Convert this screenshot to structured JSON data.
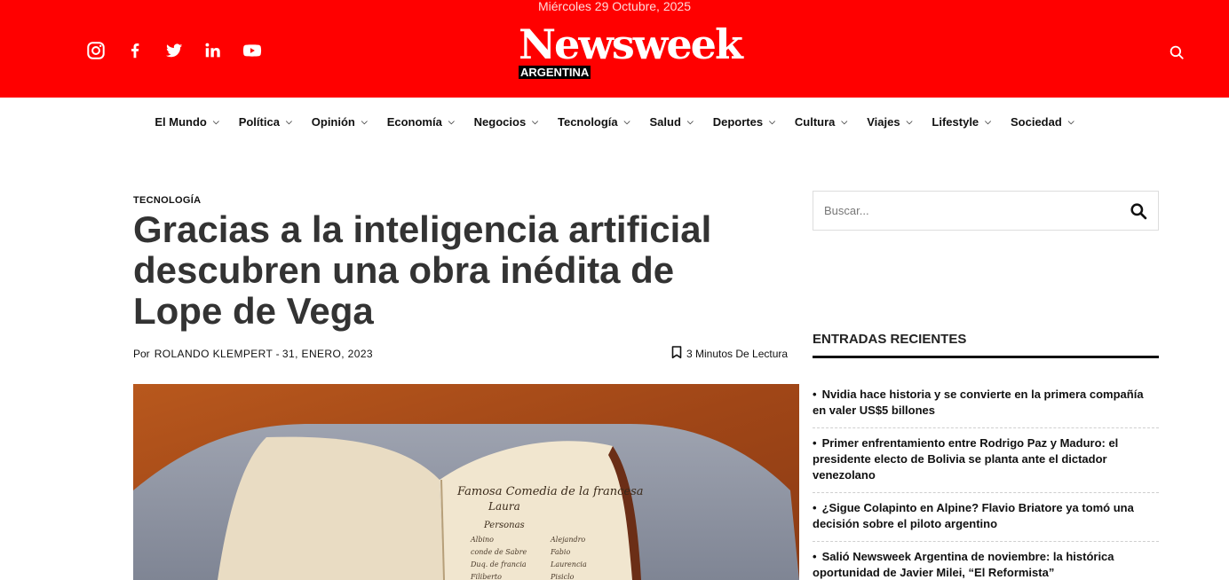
{
  "header": {
    "date": "Miércoles 29 Octubre, 2025",
    "brand": "Newsweek",
    "brand_sub": "ARGENTINA",
    "social_icons": [
      "instagram-icon",
      "facebook-icon",
      "twitter-icon",
      "linkedin-icon",
      "youtube-icon"
    ],
    "bg_color": "#ff0000"
  },
  "nav": {
    "items": [
      {
        "label": "El Mundo"
      },
      {
        "label": "Política"
      },
      {
        "label": "Opinión"
      },
      {
        "label": "Economía"
      },
      {
        "label": "Negocios"
      },
      {
        "label": "Tecnología"
      },
      {
        "label": "Salud"
      },
      {
        "label": "Deportes"
      },
      {
        "label": "Cultura"
      },
      {
        "label": "Viajes"
      },
      {
        "label": "Lifestyle"
      },
      {
        "label": "Sociedad"
      }
    ]
  },
  "article": {
    "category": "TECNOLOGÍA",
    "title": "Gracias a la inteligencia artificial descubren una obra inédita de Lope de Vega",
    "by": "Por",
    "author": "ROLANDO KLEMPERT",
    "separator": "-",
    "date": "31, ENERO, 2023",
    "reading_time": "3 Minutos De Lectura"
  },
  "sidebar": {
    "search_placeholder": "Buscar...",
    "recent_heading": "ENTRADAS RECIENTES",
    "recent": [
      "Nvidia hace historia y se convierte en la primera compañía en valer US$5 billones",
      "Primer enfrentamiento entre Rodrigo Paz y Maduro: el presidente electo de Bolivia se planta ante el dictador venezolano",
      "¿Sigue Colapinto en Alpine? Flavio Briatore ya tomó una decisión sobre el piloto argentino",
      "Salió Newsweek Argentina de noviembre: la histórica oportunidad de Javier Milei, “El Reformista”"
    ]
  }
}
